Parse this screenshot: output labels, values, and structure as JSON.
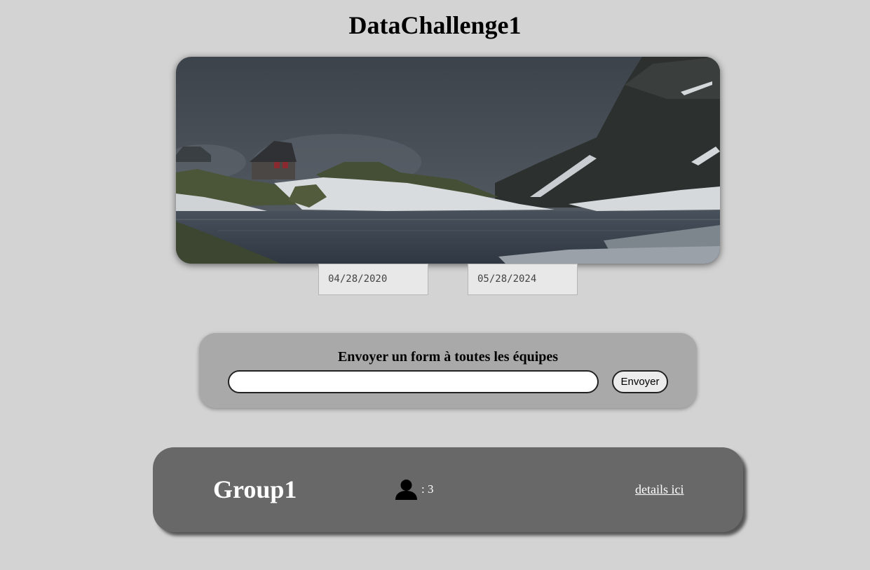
{
  "header": {
    "title": "DataChallenge1"
  },
  "hero_image": {
    "icon": "mountain-lake-hut-photo"
  },
  "date_filters": {
    "start_date": "04/28/2020",
    "end_date": "05/28/2024"
  },
  "broadcast_form": {
    "title": "Envoyer un form à toutes les équipes",
    "input_value": "",
    "send_label": "Envoyer"
  },
  "groups": [
    {
      "name": "Group1",
      "member_icon": "user-icon",
      "member_count": ": 3",
      "details_label": "details ici"
    }
  ],
  "colors": {
    "page_background": "#d3d3d3",
    "form_card": "#a9a9a9",
    "group_card": "#686868"
  }
}
